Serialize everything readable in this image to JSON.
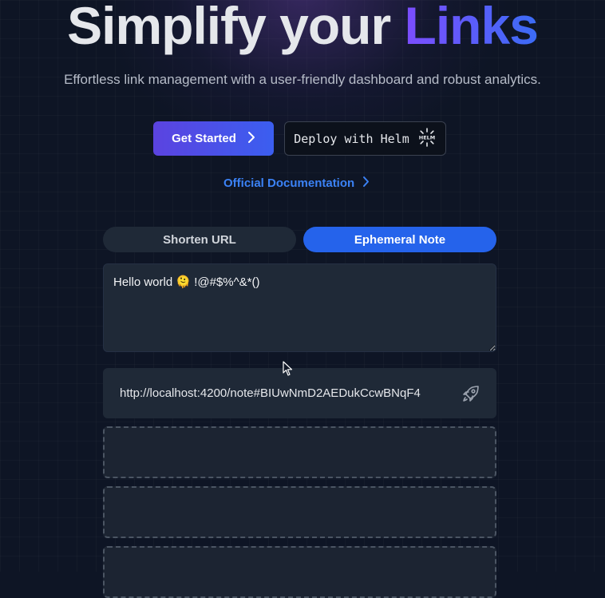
{
  "hero": {
    "title_main": "Simplify your ",
    "title_accent": "Links",
    "subtitle": "Effortless link management with a user-friendly dashboard and robust analytics."
  },
  "actions": {
    "get_started_label": "Get Started",
    "deploy_label": "Deploy with Helm",
    "helm_badge_text": "HELM",
    "docs_label": "Official Documentation"
  },
  "tabs": [
    {
      "label": "Shorten URL",
      "active": false
    },
    {
      "label": "Ephemeral Note",
      "active": true
    }
  ],
  "note": {
    "value": "Hello world 🫠 !@#$%^&*()"
  },
  "result": {
    "url": "http://localhost:4200/note#BIUwNmD2AEDukCcwBNqF4"
  },
  "colors": {
    "accent_blue": "#2563eb",
    "accent_purple": "#7c4dff",
    "link_blue": "#3b82f6",
    "panel": "#1f2937",
    "background": "#0e1525"
  },
  "icons": {
    "get_started_arrow": "chevron-right-icon",
    "docs_arrow": "chevron-right-icon",
    "helm_logo": "helm-wheel-icon",
    "result_action": "rocket-icon"
  }
}
